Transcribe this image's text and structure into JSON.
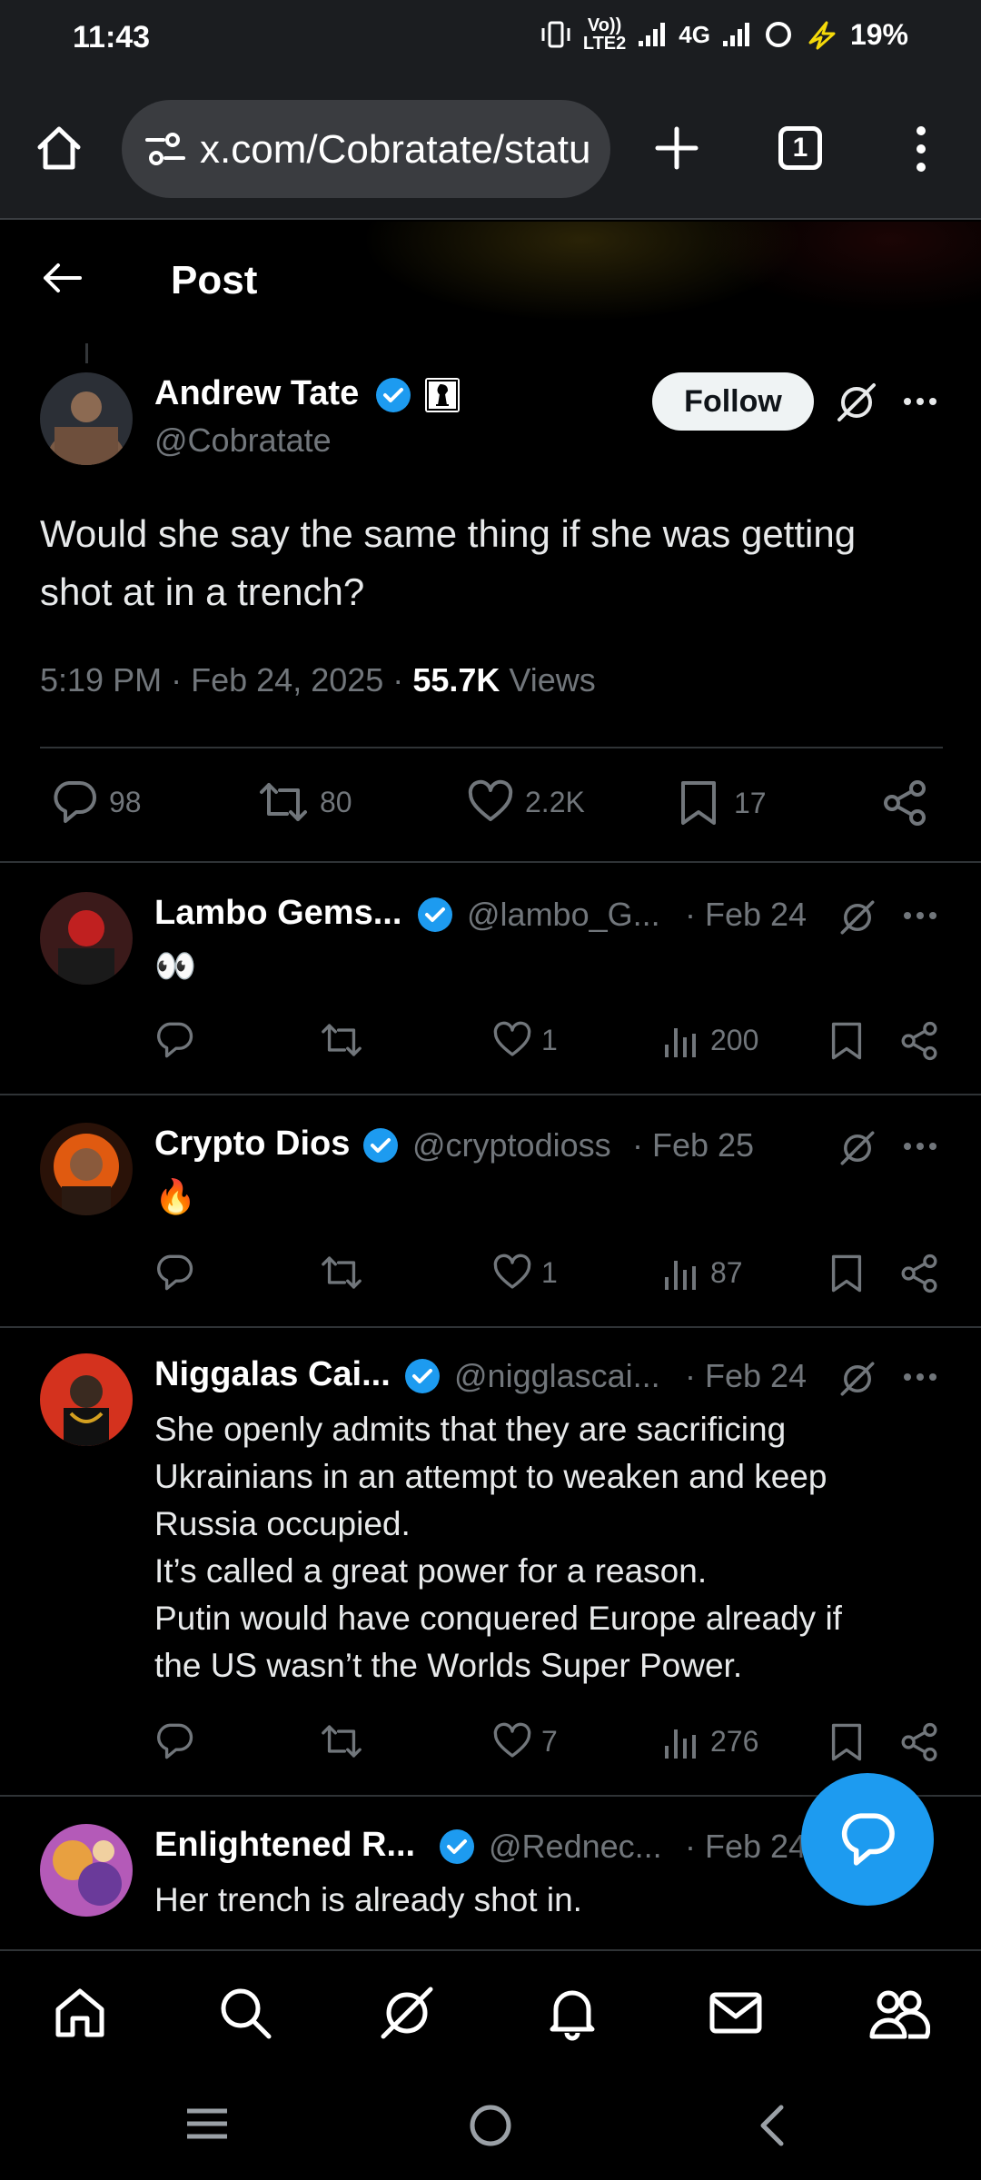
{
  "status_bar": {
    "time": "11:43",
    "volte_top": "Vo))",
    "volte_bottom": "LTE2",
    "network": "4G",
    "battery": "19%"
  },
  "browser": {
    "url": "x.com/Cobratate/statu",
    "tab_count": "1"
  },
  "header": {
    "title": "Post"
  },
  "post": {
    "author_name": "Andrew Tate",
    "author_handle": "@Cobratate",
    "follow_label": "Follow",
    "text": "Would she say the same thing if she was getting shot at in a trench?",
    "time": "5:19 PM",
    "dot1": "·",
    "date": "Feb 24, 2025",
    "dot2": "·",
    "views_count": "55.7K",
    "views_label": "Views",
    "replies": "98",
    "reposts": "80",
    "likes": "2.2K",
    "bookmarks": "17"
  },
  "replies": [
    {
      "name": "Lambo Gems...",
      "handle": "@lambo_G...",
      "date": "· Feb 24",
      "text": "👀",
      "likes": "1",
      "views": "200"
    },
    {
      "name": "Crypto Dios",
      "handle": "@cryptodioss",
      "date": "· Feb 25",
      "text": "🔥",
      "likes": "1",
      "views": "87"
    },
    {
      "name": "Niggalas Cai...",
      "handle": "@nigglascai...",
      "date": "· Feb 24",
      "lines": [
        "She openly admits that they are sacrificing",
        "Ukrainians in an attempt to weaken and keep",
        "Russia occupied.",
        "It’s called a great power for a reason.",
        "Putin would have conquered Europe already if",
        "the US wasn’t the Worlds Super Power."
      ],
      "likes": "7",
      "views": "276"
    },
    {
      "name": "Enlightened R...",
      "handle": "@Rednec...",
      "date": "· Feb 24",
      "text": "Her trench is already shot in."
    }
  ],
  "colors": {
    "accent": "#1d9bf0",
    "background": "#000000",
    "secondary_text": "#71767b",
    "divider": "#2f3336"
  },
  "icons": {
    "browser": [
      "home-icon",
      "site-settings-icon",
      "new-tab-icon",
      "tab-switcher-icon",
      "browser-menu-icon"
    ],
    "header": [
      "back-arrow-icon"
    ],
    "actions": [
      "reply-icon",
      "repost-icon",
      "like-icon",
      "views-icon",
      "bookmark-icon",
      "share-icon",
      "grok-icon",
      "more-icon"
    ],
    "bottom_nav": [
      "home-icon",
      "search-icon",
      "grok-icon",
      "notifications-icon",
      "messages-icon",
      "communities-icon"
    ],
    "system_nav": [
      "recent-apps-icon",
      "home-circle-icon",
      "back-icon"
    ]
  }
}
